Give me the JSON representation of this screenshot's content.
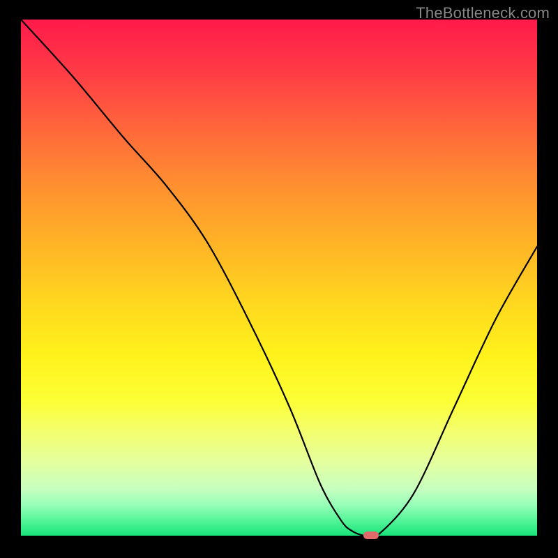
{
  "watermark": "TheBottleneck.com",
  "chart_data": {
    "type": "line",
    "title": "",
    "xlabel": "",
    "ylabel": "",
    "xlim": [
      0,
      100
    ],
    "ylim": [
      0,
      100
    ],
    "grid": false,
    "legend": false,
    "series": [
      {
        "name": "curve",
        "color": "#000000",
        "x": [
          0,
          10,
          20,
          28,
          36,
          44,
          52,
          58,
          62,
          64,
          66.5,
          69,
          76,
          84,
          92,
          100
        ],
        "values": [
          100,
          89,
          77,
          68,
          57,
          42,
          25,
          10,
          3,
          1,
          0,
          0,
          8,
          25,
          42,
          56
        ]
      }
    ],
    "marker": {
      "x": 67.8,
      "y": 0,
      "color": "#e06a6a"
    }
  }
}
